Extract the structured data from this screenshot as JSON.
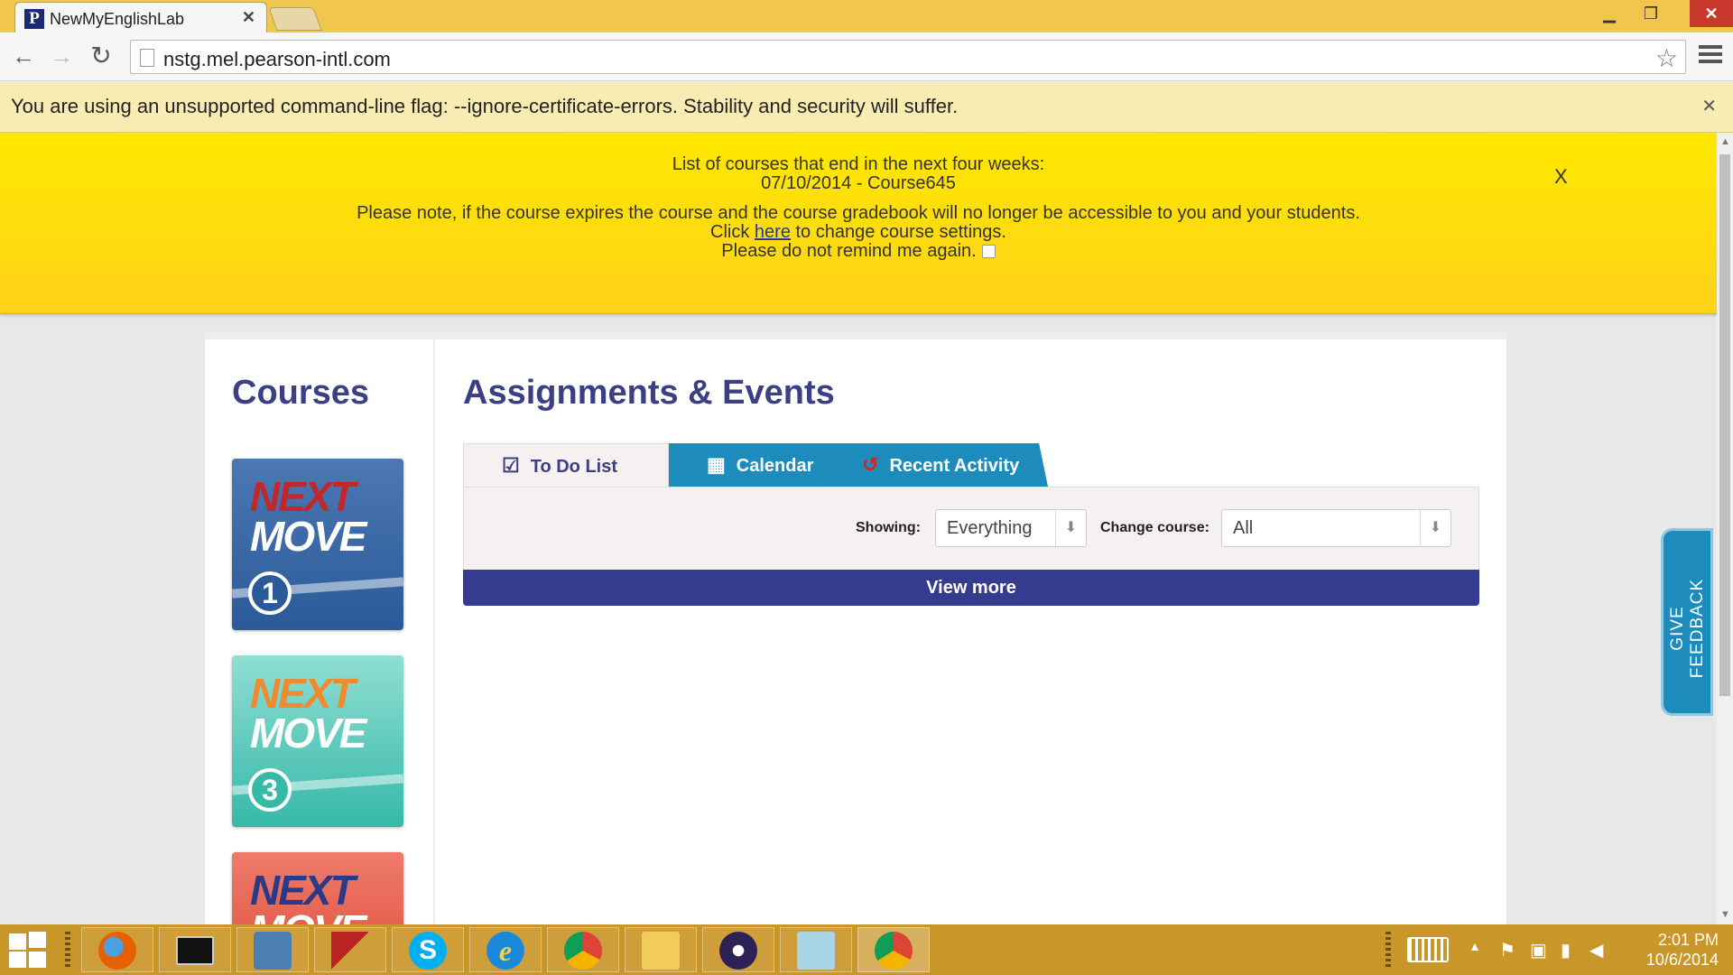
{
  "browser": {
    "tab_title": "NewMyEnglishLab",
    "tab_favicon": "P",
    "url": "nstg.mel.pearson-intl.com",
    "infobar_message": "You are using an unsupported command-line flag: --ignore-certificate-errors. Stability and security will suffer."
  },
  "notice": {
    "line1": "List of courses that end in the next four weeks:",
    "line2": "07/10/2014 - Course645",
    "line3": "Please note, if the course expires the course and the course gradebook will no longer be accessible to you and your students.",
    "line4_prefix": "Click",
    "line4_link": "here",
    "line4_suffix": "to change course settings.",
    "line5": "Please do not remind me again.",
    "close_label": "X",
    "remind_checked": false
  },
  "sidebar": {
    "title": "Courses",
    "courses": [
      {
        "logo_top": "NEXT",
        "logo_bottom": "MOVE",
        "level": "1"
      },
      {
        "logo_top": "NEXT",
        "logo_bottom": "MOVE",
        "level": "3"
      },
      {
        "logo_top": "NEXT",
        "logo_bottom": "MOVE",
        "level": ""
      }
    ]
  },
  "main": {
    "title": "Assignments & Events",
    "tabs": [
      {
        "label": "To Do List",
        "icon": "checkbox-icon"
      },
      {
        "label": "Calendar",
        "icon": "calendar-icon"
      },
      {
        "label": "Recent Activity",
        "icon": "refresh-icon"
      }
    ],
    "filters": {
      "showing_label": "Showing:",
      "showing_value": "Everything",
      "change_course_label": "Change course:",
      "change_course_value": "All"
    },
    "view_more": "View more"
  },
  "feedback_label": "GIVE FEEDBACK",
  "taskbar": {
    "time": "2:01 PM",
    "date": "10/6/2014",
    "apps": [
      "firefox",
      "command-prompt",
      "app-3",
      "app-4",
      "skype",
      "internet-explorer",
      "chrome",
      "file-explorer",
      "eclipse",
      "notepad",
      "chrome"
    ]
  },
  "colors": {
    "brand_navy": "#3a3f86",
    "tab_blue": "#1d8cbd",
    "notice_yellow": "#ffe800",
    "taskbar": "#c9962a"
  }
}
